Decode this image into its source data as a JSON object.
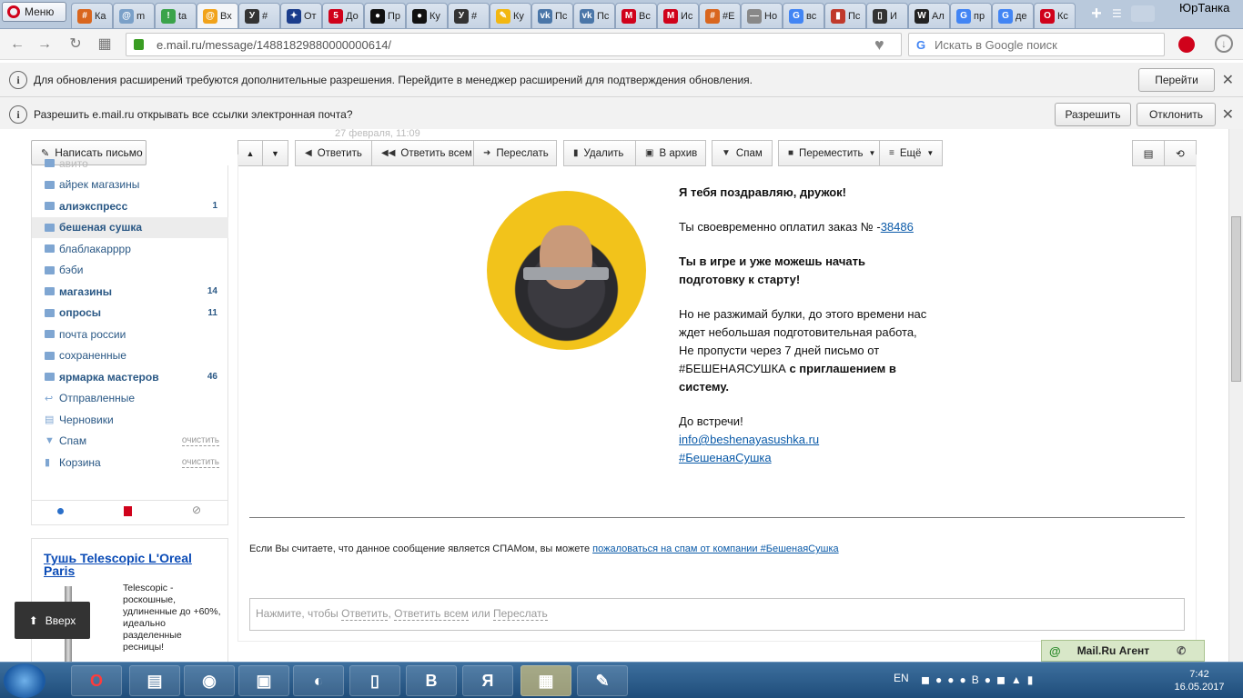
{
  "browser": {
    "menu_label": "Меню",
    "profile_name": "ЮрТанка",
    "tabs": [
      {
        "label": "Ка",
        "color": "#d9661e",
        "glyph": "#"
      },
      {
        "label": "m",
        "color": "#7aa0c8",
        "glyph": "@"
      },
      {
        "label": "ta",
        "color": "#3aa34a",
        "glyph": "!"
      },
      {
        "label": "Вх",
        "color": "#f1a31b",
        "glyph": "@"
      },
      {
        "label": "#",
        "color": "#333333",
        "glyph": "У"
      },
      {
        "label": "От",
        "color": "#1b3d8c",
        "glyph": "✦"
      },
      {
        "label": "До",
        "color": "#d0021b",
        "glyph": "5"
      },
      {
        "label": "Пр",
        "color": "#111111",
        "glyph": "●"
      },
      {
        "label": "Ку",
        "color": "#111111",
        "glyph": "●"
      },
      {
        "label": "#",
        "color": "#333333",
        "glyph": "У"
      },
      {
        "label": "Ку",
        "color": "#f2b711",
        "glyph": "✎"
      },
      {
        "label": "Пс",
        "color": "#4a76a8",
        "glyph": "vk"
      },
      {
        "label": "Пс",
        "color": "#4a76a8",
        "glyph": "vk"
      },
      {
        "label": "Вс",
        "color": "#d0021b",
        "glyph": "M"
      },
      {
        "label": "Ис",
        "color": "#d0021b",
        "glyph": "M"
      },
      {
        "label": "#E",
        "color": "#d9661e",
        "glyph": "#"
      },
      {
        "label": "Но",
        "color": "#888888",
        "glyph": "—"
      },
      {
        "label": "вс",
        "color": "#4285f4",
        "glyph": "G"
      },
      {
        "label": "Пс",
        "color": "#c0392b",
        "glyph": "▮"
      },
      {
        "label": "И",
        "color": "#333333",
        "glyph": "▯"
      },
      {
        "label": "Ал",
        "color": "#222222",
        "glyph": "W"
      },
      {
        "label": "пр",
        "color": "#4285f4",
        "glyph": "G"
      },
      {
        "label": "де",
        "color": "#4285f4",
        "glyph": "G"
      },
      {
        "label": "Кс",
        "color": "#d0021b",
        "glyph": "O"
      }
    ],
    "active_tab": 3,
    "address": "e.mail.ru/message/14881829880000000614/",
    "search_placeholder": "Искать в Google поиск",
    "infobar1": {
      "text": "Для обновления расширений требуются дополнительные разрешения. Перейдите в менеджер расширений для подтверждения обновления.",
      "button": "Перейти"
    },
    "infobar2": {
      "text": "Разрешить e.mail.ru открывать все ссылки электронная почта?",
      "allow": "Разрешить",
      "deny": "Отклонить"
    }
  },
  "mail": {
    "compose_label": "Написать письмо",
    "date_partial": "27 февраля, 11:09",
    "folders": [
      {
        "name": "авито",
        "bold": false,
        "count": "",
        "clear": "",
        "partial": true
      },
      {
        "name": "айрек магазины",
        "bold": false,
        "count": "",
        "clear": ""
      },
      {
        "name": "алиэкспресс",
        "bold": true,
        "count": "1",
        "clear": ""
      },
      {
        "name": "бешеная сушка",
        "bold": true,
        "count": "",
        "clear": "",
        "selected": true
      },
      {
        "name": "блаблакарррр",
        "bold": false,
        "count": "",
        "clear": ""
      },
      {
        "name": "бэби",
        "bold": false,
        "count": "",
        "clear": ""
      },
      {
        "name": "магазины",
        "bold": true,
        "count": "14",
        "clear": ""
      },
      {
        "name": "опросы",
        "bold": true,
        "count": "11",
        "clear": ""
      },
      {
        "name": "почта россии",
        "bold": false,
        "count": "",
        "clear": ""
      },
      {
        "name": "сохраненные",
        "bold": false,
        "count": "",
        "clear": ""
      },
      {
        "name": "ярмарка мастеров",
        "bold": true,
        "count": "46",
        "clear": ""
      },
      {
        "name": "Отправленные",
        "bold": false,
        "count": "",
        "clear": "",
        "icon": "sent"
      },
      {
        "name": "Черновики",
        "bold": false,
        "count": "",
        "clear": "",
        "icon": "drafts"
      },
      {
        "name": "Спам",
        "bold": false,
        "count": "",
        "clear": "очистить",
        "icon": "spam"
      },
      {
        "name": "Корзина",
        "bold": false,
        "count": "",
        "clear": "очистить",
        "icon": "trash"
      }
    ],
    "toolbar": {
      "reply": "Ответить",
      "reply_all": "Ответить всем",
      "forward": "Переслать",
      "delete": "Удалить",
      "archive": "В архив",
      "spam": "Спам",
      "move": "Переместить",
      "more": "Ещё"
    },
    "ad": {
      "title": "Тушь Telescopic L'Oreal Paris",
      "text": "Telescopic - роскошные, удлиненные до +60%, идеально разделенные ресницы!"
    },
    "up_label": "Вверх",
    "message": {
      "greeting": "Я тебя поздравляю, дружок!",
      "order_text": "Ты своевременно оплатил заказ № -",
      "order_no": "38486",
      "game_text": "Ты в игре и уже можешь начать подготовку к старту!",
      "p1": "Но не разжимай булки, до этого времени нас ждет небольшая подготовительная работа,",
      "p2_start": "Не пропусти через 7 дней письмо от #БЕШЕНАЯСУШКА ",
      "p2_bold": "с приглашением в систему.",
      "bye": "До встречи!",
      "email": "info@beshenayasushka.ru",
      "hashtag": "#БешенаяСушка"
    },
    "spam_note": "Если Вы считаете, что данное сообщение является СПАМом, вы можете ",
    "spam_link": "пожаловаться на спам от компании #БешенаяСушка",
    "reply_box": {
      "prefix": "Нажмите, чтобы ",
      "reply": "Ответить",
      "sep": ", ",
      "reply_all": "Ответить всем",
      "or": " или ",
      "forward": "Переслать"
    },
    "agent_label": "Mail.Ru Агент"
  },
  "taskbar": {
    "lang": "EN",
    "time": "7:42",
    "date": "16.05.2017",
    "apps": [
      "O",
      "▤",
      "◉",
      "▣",
      "◐",
      "▯",
      "B",
      "Я",
      "▦",
      "✎"
    ]
  }
}
